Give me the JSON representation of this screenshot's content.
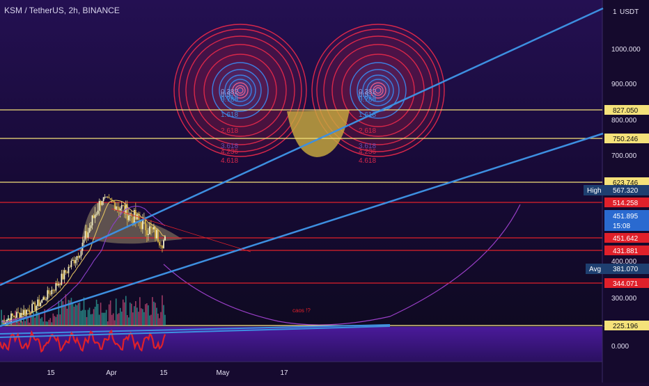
{
  "chart_data": {
    "type": "line",
    "title": "KSM / TetherUS, 2h, BINANCE",
    "price_axis": {
      "currency": "USDT",
      "currency_prefix": "1",
      "ticks": [
        1000,
        900,
        800,
        700,
        400,
        300
      ],
      "tick_labels": [
        "1000.000",
        "900.000",
        "800.000",
        "700.000",
        "400.000",
        "300.000"
      ],
      "range": [
        225,
        1120
      ]
    },
    "time_axis": {
      "labels": [
        "15",
        "Apr",
        "15",
        "May",
        "17"
      ]
    },
    "horizontal_levels": [
      {
        "value": 827.05,
        "label": "827.050",
        "color": "#f5e27a"
      },
      {
        "value": 750.246,
        "label": "750.246",
        "color": "#f5e27a"
      },
      {
        "value": 623.746,
        "label": "623.746",
        "color": "#f5e27a"
      },
      {
        "value": 514.258,
        "label": "514.258",
        "color": "#e0202a"
      },
      {
        "value": 451.642,
        "label": "451.642",
        "color": "#e0202a"
      },
      {
        "value": 431.881,
        "label": "431.881",
        "color": "#e0202a"
      },
      {
        "value": 344.071,
        "label": "344.071",
        "color": "#e0202a"
      },
      {
        "value": 225.196,
        "label": "225.196",
        "color": "#f5e27a"
      }
    ],
    "markers": {
      "high": {
        "label": "High",
        "value": "567.320"
      },
      "avg": {
        "label": "Avg",
        "value": "381.070"
      },
      "last": {
        "value": "451.895",
        "countdown": "15:08"
      }
    },
    "fib_circle_labels": [
      "0.382",
      "0.5",
      "0.618",
      "0.786",
      "1.618",
      "2.618",
      "3.618",
      "4.236",
      "4.618"
    ],
    "annotation": "caos !?",
    "indicator": {
      "tick_label": "0.000"
    }
  },
  "colors": {
    "trendline": "#3d8fe0",
    "level_yellow": "#f5e27a",
    "level_red": "#e0202a",
    "arc": "#9a3fc8",
    "fib_red": "#d8274a",
    "fib_blue": "#3d7ee0",
    "bear_bg": "#1f2a35"
  }
}
